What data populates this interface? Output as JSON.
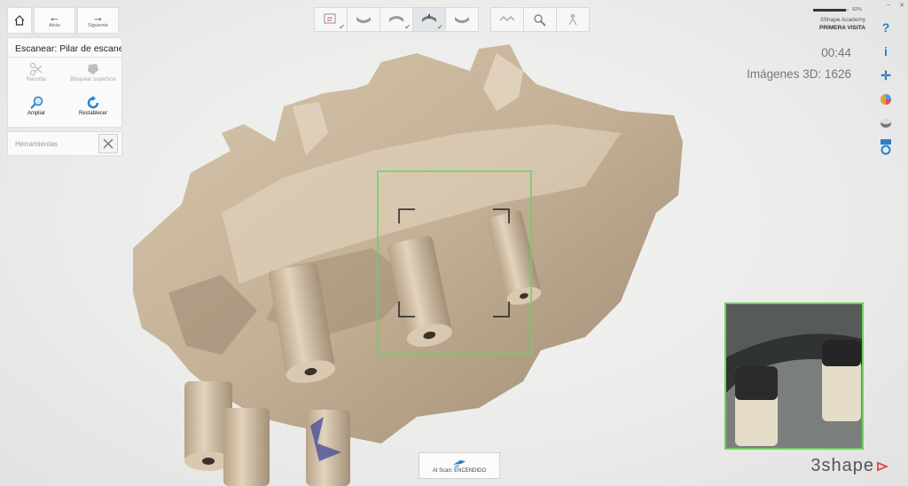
{
  "nav": {
    "back_label": "Atrás",
    "forward_label": "Siguiente"
  },
  "panel": {
    "title": "Escanear: Pilar de escaneado",
    "tools": [
      {
        "label": "Recortar",
        "enabled": false
      },
      {
        "label": "Bloquear superficie",
        "enabled": false
      },
      {
        "label": "Ampliar",
        "enabled": true
      },
      {
        "label": "Restablecer",
        "enabled": true
      }
    ],
    "tools_section_label": "Herramientas"
  },
  "account": {
    "name": "3Shape Academy",
    "visit": "PRIMERA VISITA"
  },
  "battery": {
    "percent_text": "92%",
    "level": 0.92
  },
  "status": {
    "timer": "00:44",
    "images_3d": "Imágenes 3D: 1626"
  },
  "workflow": {
    "steps": [
      {
        "icon": "prescription-icon",
        "done": true
      },
      {
        "icon": "upper-jaw-icon",
        "done": false
      },
      {
        "icon": "lower-jaw-icon",
        "done": true
      },
      {
        "icon": "scanbody-jaw-icon",
        "done": true,
        "active": true
      },
      {
        "icon": "jaw-icon",
        "done": false
      },
      {
        "icon": "bite-icon",
        "done": false
      },
      {
        "icon": "analysis-icon",
        "done": false
      },
      {
        "icon": "send-icon",
        "done": false
      }
    ]
  },
  "right_toolbar": [
    "help-icon",
    "info-icon",
    "move-icon",
    "color-icon",
    "texture-icon",
    "settings-icon"
  ],
  "ai_scan": {
    "label": "AI Scan: ENCENDIDO"
  },
  "brand": {
    "name": "3shape"
  },
  "colors": {
    "accent_blue": "#2a7fc7",
    "scan_box_green": "#6dd05f",
    "model_beige": "#c8b59a",
    "check_green": "#4caf50"
  }
}
